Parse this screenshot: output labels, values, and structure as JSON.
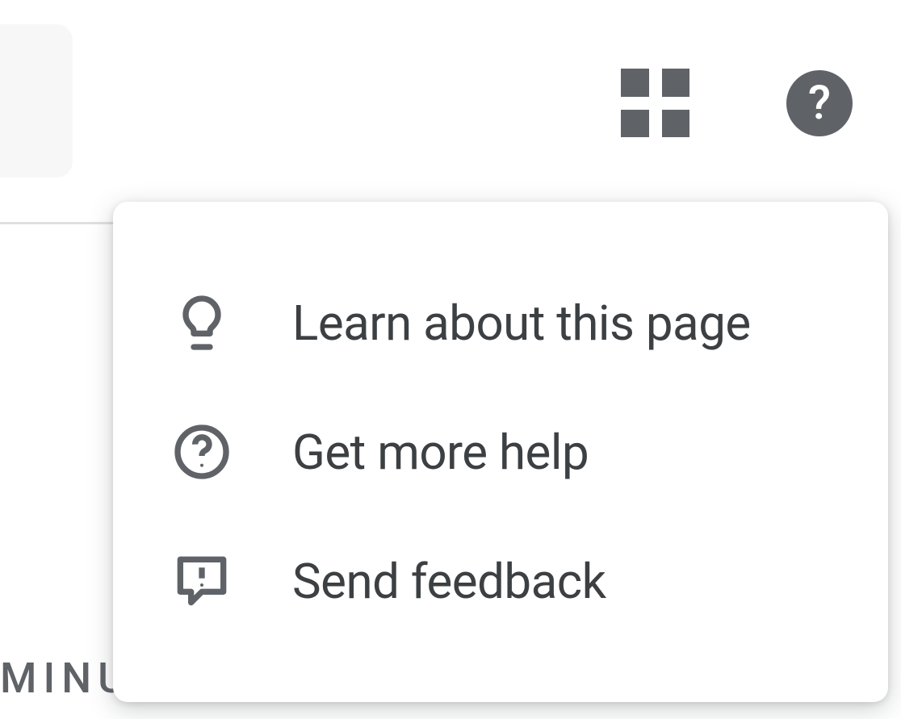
{
  "toolbar": {
    "apps_name": "apps-grid",
    "help_name": "help",
    "help_glyph": "?"
  },
  "menu": {
    "items": [
      {
        "icon": "lightbulb",
        "label": "Learn about this page"
      },
      {
        "icon": "help-circle-outline",
        "label": "Get more help"
      },
      {
        "icon": "feedback",
        "label": "Send feedback"
      }
    ]
  },
  "background": {
    "clipped_text": "MINU"
  }
}
